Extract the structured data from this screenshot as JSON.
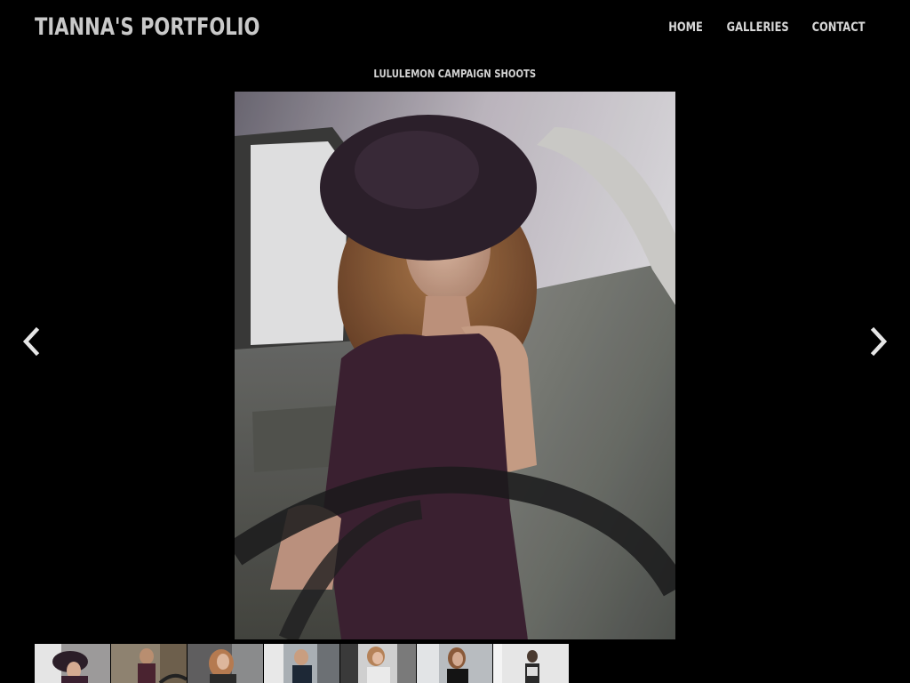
{
  "header": {
    "site_title": "TIANNA'S PORTFOLIO"
  },
  "nav": {
    "items": [
      {
        "label": "HOME"
      },
      {
        "label": "GALLERIES"
      },
      {
        "label": "CONTACT"
      }
    ]
  },
  "gallery": {
    "title": "LULULEMON CAMPAIGN SHOOTS",
    "main_photo_alt": "Woman in wide-brim hat seated in car back seat",
    "prev_icon": "chevron-left-icon",
    "next_icon": "chevron-right-icon",
    "thumbnail_count": 7
  },
  "colors": {
    "background": "#000000",
    "text": "#d8d8d8"
  }
}
